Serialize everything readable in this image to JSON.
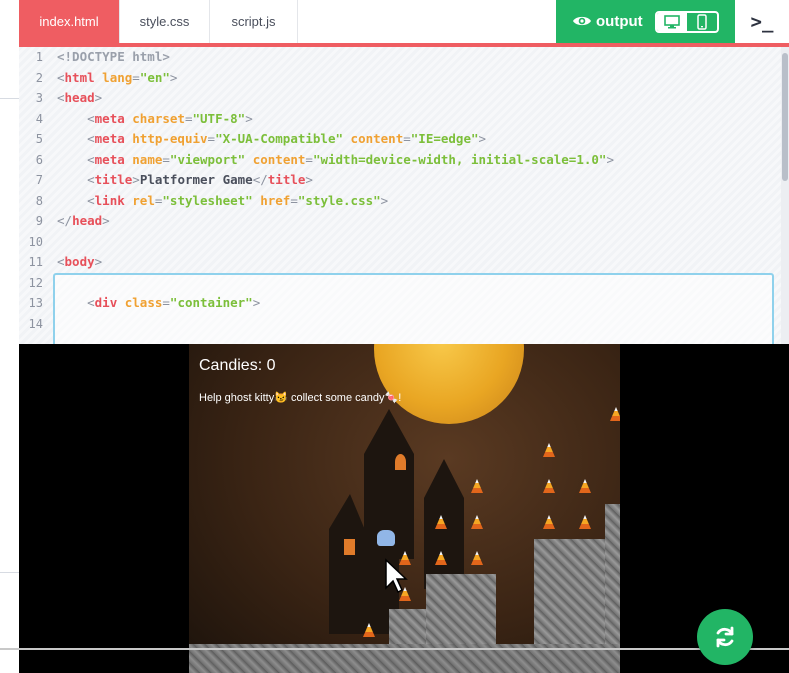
{
  "tabs": [
    {
      "label": "index.html",
      "active": true
    },
    {
      "label": "style.css",
      "active": false
    },
    {
      "label": "script.js",
      "active": false
    }
  ],
  "output": {
    "label": "output",
    "eye_icon": "eye-icon",
    "desktop_icon": "monitor-icon",
    "mobile_icon": "phone-icon"
  },
  "terminal": {
    "label": ">_"
  },
  "colors": {
    "accent": "#ef5d62",
    "green": "#22b565",
    "tag": "#e7505a",
    "attr": "#f0a132",
    "string": "#7cbf3a"
  },
  "code_lines": [
    {
      "n": "1",
      "doctype": "<!DOCTYPE html>"
    },
    {
      "n": "2",
      "tag": "html",
      "attrs": [
        {
          "name": "lang",
          "value": "\"en\""
        }
      ]
    },
    {
      "n": "3",
      "tag": "head"
    },
    {
      "n": "4",
      "tag": "meta",
      "attrs": [
        {
          "name": "charset",
          "value": "\"UTF-8\""
        }
      ]
    },
    {
      "n": "5",
      "tag": "meta",
      "attrs": [
        {
          "name": "http-equiv",
          "value": "\"X-UA-Compatible\""
        },
        {
          "name": "content",
          "value": "\"IE=edge\""
        }
      ]
    },
    {
      "n": "6",
      "tag": "meta",
      "attrs": [
        {
          "name": "name",
          "value": "\"viewport\""
        },
        {
          "name": "content",
          "value": "\"width=device-width, initial-scale=1.0\""
        }
      ]
    },
    {
      "n": "7",
      "tag": "title",
      "text": "Platformer Game",
      "close": "title"
    },
    {
      "n": "8",
      "tag": "link",
      "attrs": [
        {
          "name": "rel",
          "value": "\"stylesheet\""
        },
        {
          "name": "href",
          "value": "\"style.css\""
        }
      ]
    },
    {
      "n": "9",
      "close_only": "head"
    },
    {
      "n": "10"
    },
    {
      "n": "11",
      "tag": "body"
    },
    {
      "n": "12"
    },
    {
      "n": "13",
      "tag": "div",
      "attrs": [
        {
          "name": "class",
          "value": "\"container\""
        }
      ]
    },
    {
      "n": "14"
    }
  ],
  "game": {
    "candies_label": "Candies: 0",
    "help_text": "Help ghost kitty😼 collect some candy🍬!"
  },
  "refresh": {
    "icon": "refresh-icon"
  }
}
